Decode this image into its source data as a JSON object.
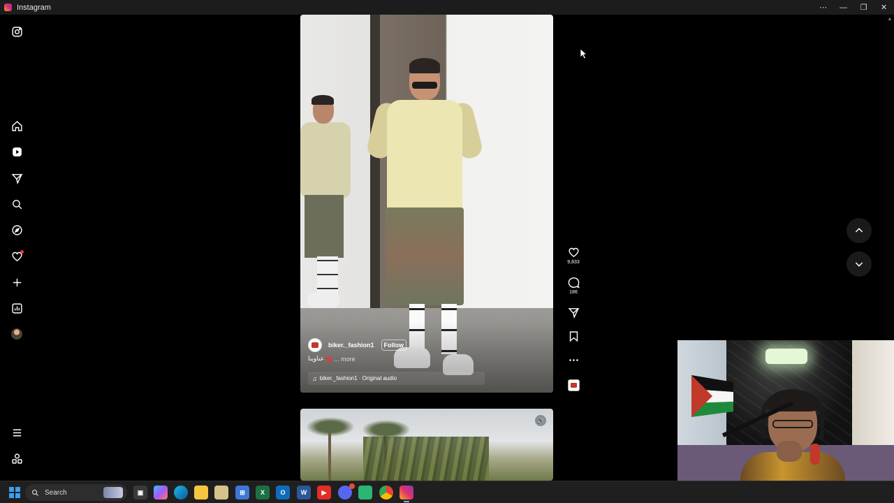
{
  "window": {
    "title": "Instagram",
    "controls": [
      "more",
      "minimize",
      "restore",
      "close"
    ]
  },
  "sidebar": {
    "items": [
      {
        "name": "instagram-logo-icon",
        "label": "Instagram"
      },
      {
        "name": "home-icon",
        "label": "Home"
      },
      {
        "name": "reels-icon",
        "label": "Reels"
      },
      {
        "name": "messages-icon",
        "label": "Messages"
      },
      {
        "name": "search-icon",
        "label": "Search"
      },
      {
        "name": "explore-icon",
        "label": "Explore"
      },
      {
        "name": "notifications-icon",
        "label": "Notifications",
        "has_dot": true
      },
      {
        "name": "create-icon",
        "label": "Create"
      },
      {
        "name": "dashboard-icon",
        "label": "Dashboard"
      },
      {
        "name": "profile-avatar",
        "label": "Profile"
      },
      {
        "name": "menu-icon",
        "label": "More"
      },
      {
        "name": "also-from-meta-icon",
        "label": "Also from Meta"
      }
    ]
  },
  "reel": {
    "author": "biker._fashion1",
    "follow_label": "Follow",
    "caption": "عناوينا",
    "more_label": "... more",
    "audio": "biker._fashion1 · Original audio",
    "likes": "9,833",
    "comments": "186"
  },
  "taskbar": {
    "search_placeholder": "Search",
    "apps": [
      "task-view",
      "copilot",
      "edge",
      "file-explorer",
      "notes",
      "store",
      "excel",
      "outlook",
      "word",
      "youtube",
      "discord",
      "app-green",
      "chrome",
      "instagram"
    ]
  },
  "colors": {
    "accent": "#ff3040",
    "background": "#000000",
    "taskbar": "#1f1f1f"
  }
}
